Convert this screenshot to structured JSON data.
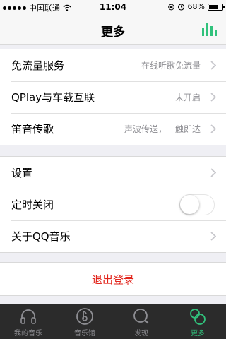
{
  "status_bar": {
    "carrier": "中国联通",
    "time": "11:04",
    "battery": "68%",
    "battery_level": 0.68
  },
  "nav": {
    "title": "更多",
    "right_icon": "bars-chart-icon",
    "accent_color": "#31c27c"
  },
  "group1": {
    "items": [
      {
        "label": "免流量服务",
        "detail": "在线听歌免流量"
      },
      {
        "label": "QPlay与车载互联",
        "detail": "未开启"
      },
      {
        "label": "笛音传歌",
        "detail": "声波传送，一触即达"
      }
    ]
  },
  "group2": {
    "items": [
      {
        "label": "设置"
      },
      {
        "label": "定时关闭",
        "toggle_on": false
      },
      {
        "label": "关于QQ音乐"
      }
    ]
  },
  "logout": {
    "label": "退出登录",
    "color": "#e2231a"
  },
  "tabs": [
    {
      "label": "我的音乐",
      "icon": "headphones-icon",
      "active": false
    },
    {
      "label": "音乐馆",
      "icon": "music-note-icon",
      "active": false
    },
    {
      "label": "发现",
      "icon": "discover-icon",
      "active": false
    },
    {
      "label": "更多",
      "icon": "more-icon",
      "active": true
    }
  ]
}
